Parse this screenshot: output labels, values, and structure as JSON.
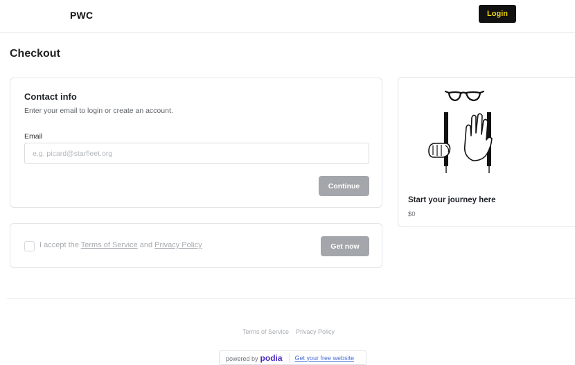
{
  "header": {
    "brand": "PWC",
    "login_label": "Login"
  },
  "page": {
    "title": "Checkout"
  },
  "contact": {
    "title": "Contact info",
    "subtitle": "Enter your email to login or create an account.",
    "email_label": "Email",
    "email_placeholder": "e.g. picard@starfleet.org",
    "email_value": "",
    "continue_label": "Continue"
  },
  "terms": {
    "prefix": "I accept the ",
    "tos": "Terms of Service",
    "and": " and ",
    "privacy": "Privacy Policy",
    "checked": false,
    "get_now_label": "Get now"
  },
  "product": {
    "title": "Start your journey here",
    "price": "$0",
    "image_icon": "glasses-suspenders-illustration"
  },
  "footer": {
    "terms_link": "Terms of Service",
    "privacy_link": "Privacy Policy",
    "powered_by": "powered by",
    "podia": "podia",
    "free_website": "Get your free website"
  },
  "colors": {
    "login_bg": "#111111",
    "login_text": "#f5d90a",
    "disabled_button": "#a3a6aa",
    "podia_brand": "#4b2ac0",
    "link_blue": "#4a6fd8"
  }
}
